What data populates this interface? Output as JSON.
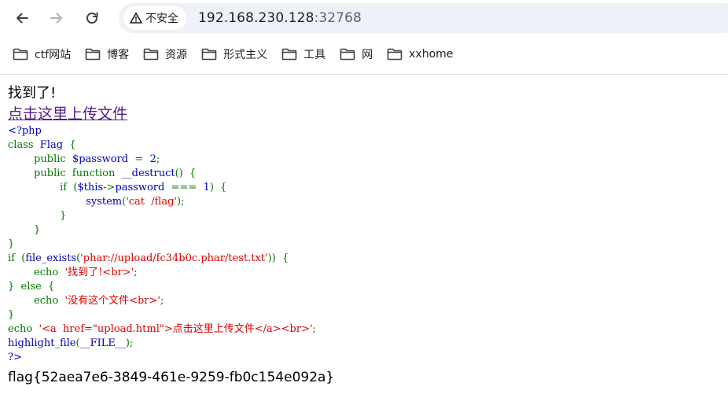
{
  "browser": {
    "security_label": "不安全",
    "url_host": "192.168.230.128",
    "url_port": ":32768"
  },
  "bookmarks": [
    {
      "label": "ctf网站",
      "icon": "folder-icon"
    },
    {
      "label": "博客",
      "icon": "folder-icon"
    },
    {
      "label": "资源",
      "icon": "folder-icon"
    },
    {
      "label": "形式主义",
      "icon": "folder-icon"
    },
    {
      "label": "工具",
      "icon": "folder-icon"
    },
    {
      "label": "网",
      "icon": "folder-icon"
    },
    {
      "label": "xxhome",
      "icon": "folder-icon"
    }
  ],
  "page": {
    "found_text": "找到了!",
    "upload_link_text": "点击这里上传文件",
    "flag": "flag{52aea7e6-3849-461e-9259-fb0c154e092a}"
  },
  "source_code": [
    [
      {
        "t": "<?php",
        "c": "#0000bb"
      }
    ],
    [
      {
        "t": "class  ",
        "c": "#007700"
      },
      {
        "t": "Flag  ",
        "c": "#0000bb"
      },
      {
        "t": "{",
        "c": "#007700"
      }
    ],
    [
      {
        "t": "        public  ",
        "c": "#007700"
      },
      {
        "t": "$password  ",
        "c": "#0000bb"
      },
      {
        "t": "=  ",
        "c": "#007700"
      },
      {
        "t": "2",
        "c": "#0000bb"
      },
      {
        "t": ";",
        "c": "#007700"
      }
    ],
    [
      {
        "t": "        public  function  ",
        "c": "#007700"
      },
      {
        "t": "__destruct",
        "c": "#0000bb"
      },
      {
        "t": "()  {",
        "c": "#007700"
      }
    ],
    [
      {
        "t": "                if  (",
        "c": "#007700"
      },
      {
        "t": "$this",
        "c": "#0000bb"
      },
      {
        "t": "->",
        "c": "#007700"
      },
      {
        "t": "password  ",
        "c": "#0000bb"
      },
      {
        "t": "===  ",
        "c": "#007700"
      },
      {
        "t": "1",
        "c": "#0000bb"
      },
      {
        "t": ")  {",
        "c": "#007700"
      }
    ],
    [
      {
        "t": "                        ",
        "c": "#007700"
      },
      {
        "t": "system",
        "c": "#0000bb"
      },
      {
        "t": "(",
        "c": "#007700"
      },
      {
        "t": "'cat  /flag'",
        "c": "#dd0000"
      },
      {
        "t": ");",
        "c": "#007700"
      }
    ],
    [
      {
        "t": "                }",
        "c": "#007700"
      }
    ],
    [
      {
        "t": "        }",
        "c": "#007700"
      }
    ],
    [
      {
        "t": "}",
        "c": "#007700"
      }
    ],
    [
      {
        "t": "if  (",
        "c": "#007700"
      },
      {
        "t": "file_exists",
        "c": "#0000bb"
      },
      {
        "t": "(",
        "c": "#007700"
      },
      {
        "t": "'phar://upload/fc34b0c.phar/test.txt'",
        "c": "#dd0000"
      },
      {
        "t": "))  {",
        "c": "#007700"
      }
    ],
    [
      {
        "t": "        echo  ",
        "c": "#007700"
      },
      {
        "t": "'找到了!<br>'",
        "c": "#dd0000"
      },
      {
        "t": ";",
        "c": "#007700"
      }
    ],
    [
      {
        "t": "}  else  {",
        "c": "#007700"
      }
    ],
    [
      {
        "t": "        echo  ",
        "c": "#007700"
      },
      {
        "t": "'没有这个文件<br>'",
        "c": "#dd0000"
      },
      {
        "t": ";",
        "c": "#007700"
      }
    ],
    [
      {
        "t": "}",
        "c": "#007700"
      }
    ],
    [
      {
        "t": "echo  ",
        "c": "#007700"
      },
      {
        "t": "'<a  href=\"upload.html\">点击这里上传文件</a><br>'",
        "c": "#dd0000"
      },
      {
        "t": ";",
        "c": "#007700"
      }
    ],
    [
      {
        "t": "highlight_file",
        "c": "#0000bb"
      },
      {
        "t": "(",
        "c": "#007700"
      },
      {
        "t": "__FILE__",
        "c": "#0000bb"
      },
      {
        "t": ");",
        "c": "#007700"
      }
    ],
    [
      {
        "t": "?>",
        "c": "#0000bb"
      }
    ]
  ]
}
